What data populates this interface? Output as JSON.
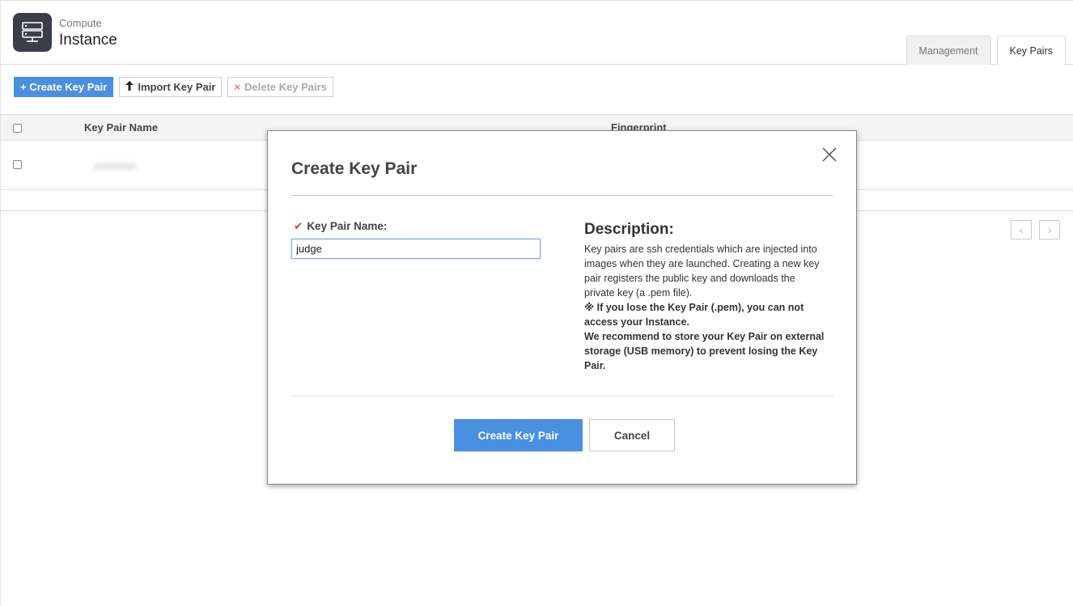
{
  "header": {
    "breadcrumb": "Compute",
    "title": "Instance",
    "tabs": [
      {
        "label": "Management",
        "active": false
      },
      {
        "label": "Key Pairs",
        "active": true
      }
    ]
  },
  "toolbar": {
    "create_label": "+ Create Key Pair",
    "import_label": "Import Key Pair",
    "delete_label": "Delete Key Pairs"
  },
  "table": {
    "columns": [
      "Key Pair Name",
      "Fingerprint"
    ],
    "rows": [
      {
        "name": "xxxxxxxx",
        "blurred": true
      }
    ]
  },
  "pager": {
    "prev": "‹",
    "next": "›"
  },
  "modal": {
    "title": "Create Key Pair",
    "field_label": "Key Pair Name:",
    "field_value": "judge",
    "description_title": "Description:",
    "description_text": "Key pairs are ssh credentials which are injected into images when they are launched. Creating a new key pair registers the public key and downloads the private key (a .pem file).",
    "warning_text": "※ If you lose the Key Pair (.pem), you can not access your Instance.",
    "recommend_text": "We recommend to store your Key Pair on external storage (USB memory) to prevent losing the Key Pair.",
    "create_button": "Create Key Pair",
    "cancel_button": "Cancel"
  },
  "colors": {
    "primary": "#4a90e2",
    "required_mark": "#d9401c",
    "icon_bg": "#3a3f47"
  }
}
